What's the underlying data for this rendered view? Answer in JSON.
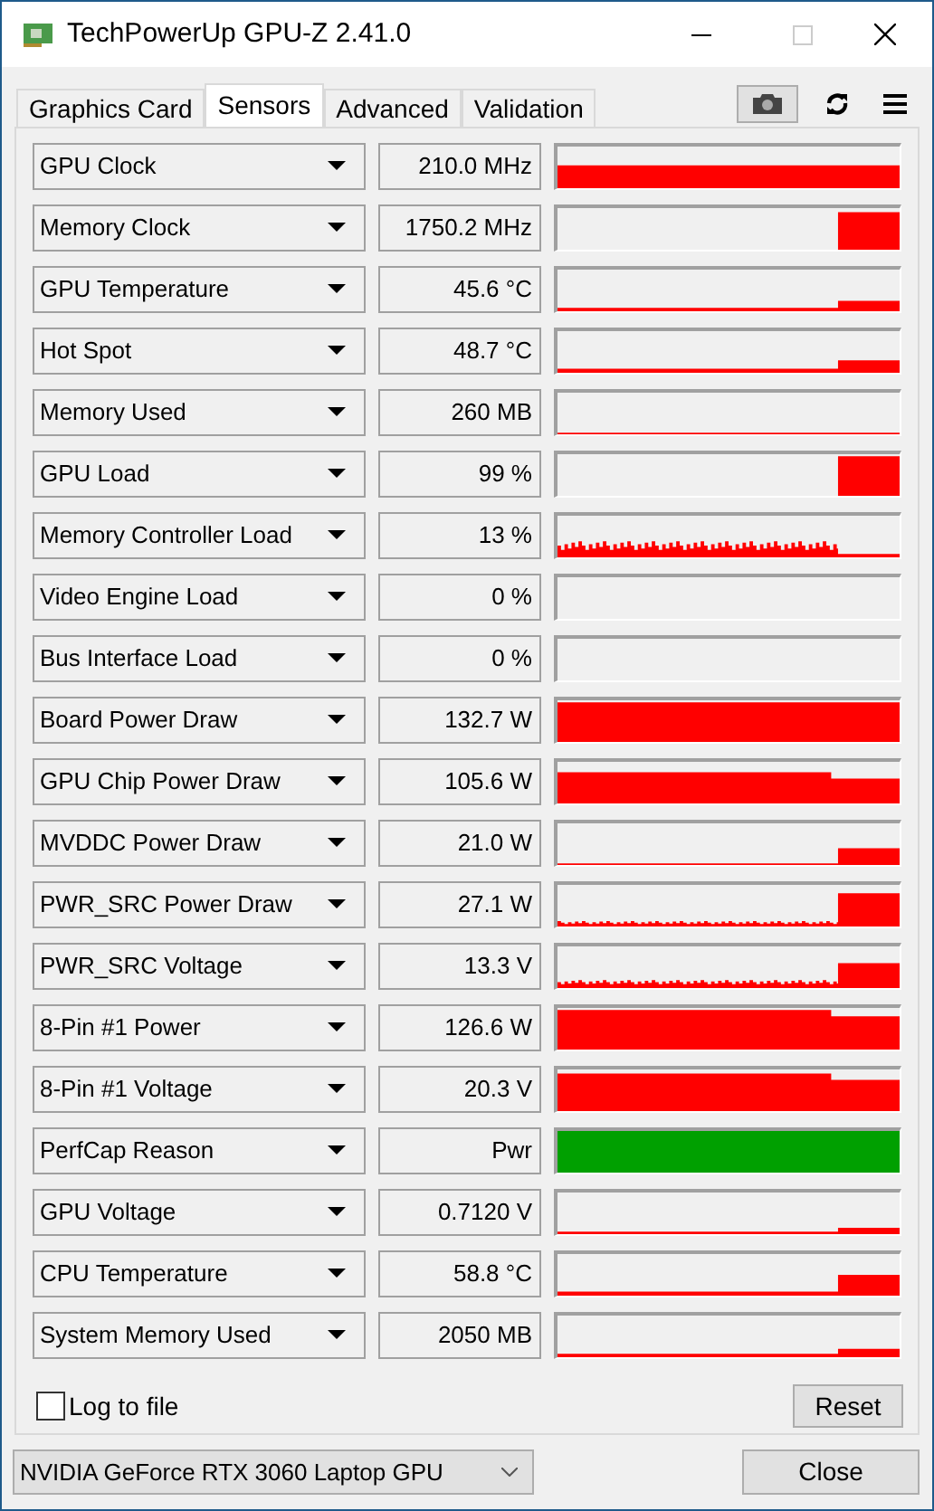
{
  "window": {
    "title": "TechPowerUp GPU-Z 2.41.0"
  },
  "tabs": [
    {
      "label": "Graphics Card",
      "selected": false
    },
    {
      "label": "Sensors",
      "selected": true
    },
    {
      "label": "Advanced",
      "selected": false
    },
    {
      "label": "Validation",
      "selected": false
    }
  ],
  "sensors": [
    {
      "name": "GPU Clock",
      "value": "210.0 MHz",
      "kind": "graph"
    },
    {
      "name": "Memory Clock",
      "value": "1750.2 MHz",
      "kind": "graph"
    },
    {
      "name": "GPU Temperature",
      "value": "45.6 °C",
      "kind": "graph"
    },
    {
      "name": "Hot Spot",
      "value": "48.7 °C",
      "kind": "graph"
    },
    {
      "name": "Memory Used",
      "value": "260 MB",
      "kind": "graph"
    },
    {
      "name": "GPU Load",
      "value": "99 %",
      "kind": "graph"
    },
    {
      "name": "Memory Controller Load",
      "value": "13 %",
      "kind": "graph"
    },
    {
      "name": "Video Engine Load",
      "value": "0 %",
      "kind": "graph"
    },
    {
      "name": "Bus Interface Load",
      "value": "0 %",
      "kind": "graph"
    },
    {
      "name": "Board Power Draw",
      "value": "132.7 W",
      "kind": "graph"
    },
    {
      "name": "GPU Chip Power Draw",
      "value": "105.6 W",
      "kind": "graph"
    },
    {
      "name": "MVDDC Power Draw",
      "value": "21.0 W",
      "kind": "graph"
    },
    {
      "name": "PWR_SRC Power Draw",
      "value": "27.1 W",
      "kind": "graph"
    },
    {
      "name": "PWR_SRC Voltage",
      "value": "13.3 V",
      "kind": "graph"
    },
    {
      "name": "8-Pin #1 Power",
      "value": "126.6 W",
      "kind": "graph"
    },
    {
      "name": "8-Pin #1 Voltage",
      "value": "20.3 V",
      "kind": "graph"
    },
    {
      "name": "PerfCap Reason",
      "value": "Pwr",
      "kind": "status"
    },
    {
      "name": "GPU Voltage",
      "value": "0.7120 V",
      "kind": "graph"
    },
    {
      "name": "CPU Temperature",
      "value": "58.8 °C",
      "kind": "graph"
    },
    {
      "name": "System Memory Used",
      "value": "2050 MB",
      "kind": "graph"
    }
  ],
  "log_to_file": {
    "label": "Log to file",
    "checked": false
  },
  "reset_button": "Reset",
  "gpu_select": {
    "value": "NVIDIA GeForce RTX 3060 Laptop GPU"
  },
  "close_button": "Close"
}
